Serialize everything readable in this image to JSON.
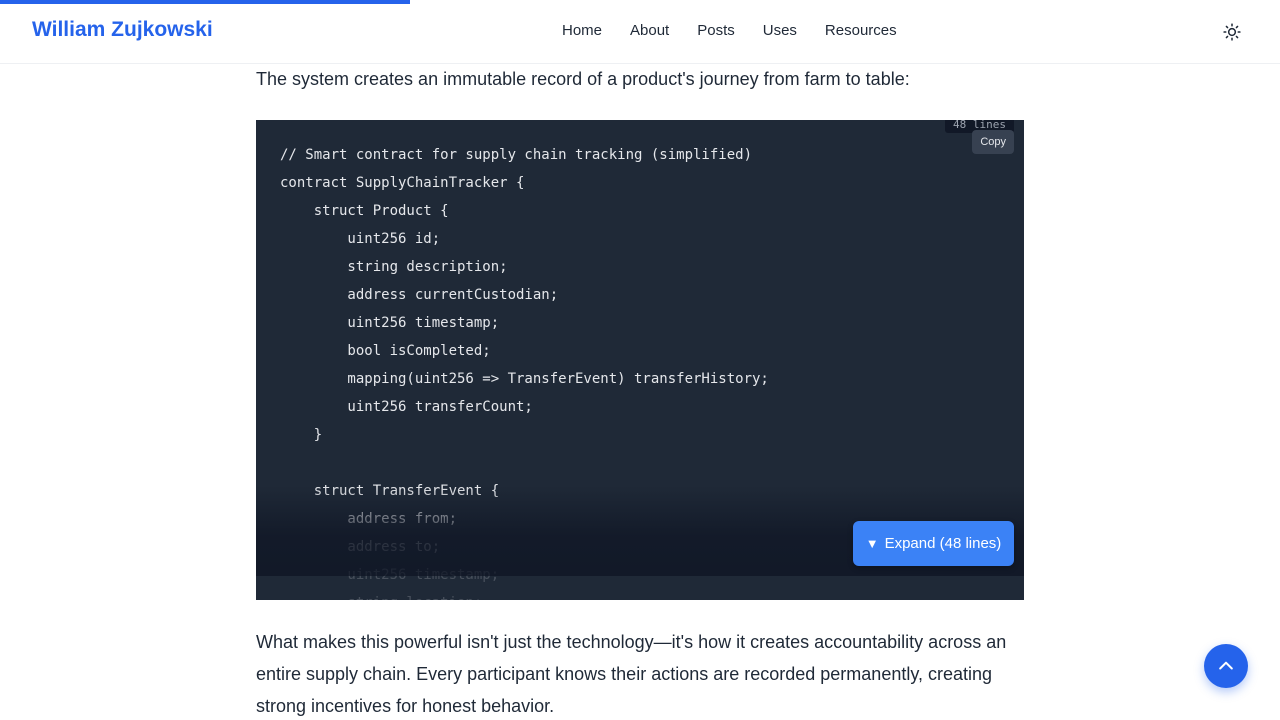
{
  "site": {
    "title": "William Zujkowski",
    "accent_color": "#2563eb",
    "reading_progress": 0.32
  },
  "nav": {
    "items": [
      {
        "label": "Home"
      },
      {
        "label": "About"
      },
      {
        "label": "Posts"
      },
      {
        "label": "Uses"
      },
      {
        "label": "Resources"
      }
    ],
    "theme_toggle_icon": "sun-icon"
  },
  "article": {
    "intro": "The system creates an immutable record of a product's journey from farm to table:",
    "code": {
      "line_count_label": "48 lines",
      "copy_label": "Copy",
      "expand_label": "Expand (48 lines)",
      "lines": [
        "// Smart contract for supply chain tracking (simplified)",
        "contract SupplyChainTracker {",
        "    struct Product {",
        "        uint256 id;",
        "        string description;",
        "        address currentCustodian;",
        "        uint256 timestamp;",
        "        bool isCompleted;",
        "        mapping(uint256 => TransferEvent) transferHistory;",
        "        uint256 transferCount;",
        "    }",
        "",
        "    struct TransferEvent {",
        "        address from;",
        "        address to;",
        "        uint256 timestamp;",
        "        string location;"
      ]
    },
    "paragraph": "What makes this powerful isn't just the technology—it's how it creates accountability across an entire supply chain. Every participant knows their actions are recorded permanently, creating strong incentives for honest behavior."
  },
  "scroll_top_icon": "chevron-up-icon"
}
